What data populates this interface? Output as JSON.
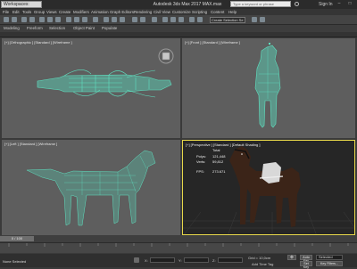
{
  "window": {
    "workspace": "Workspaces: Default",
    "title": "Autodesk 3ds Max 2017    MAX.max",
    "search_placeholder": "Type a keyword or phrase",
    "signin": "Sign In",
    "min": "–",
    "max": "□",
    "close": "✕"
  },
  "menu": [
    "File",
    "Edit",
    "Tools",
    "Group",
    "Views",
    "Create",
    "Modifiers",
    "Animation",
    "Graph Editors",
    "Rendering",
    "Civil View",
    "Customize",
    "Scripting",
    "Content",
    "Help"
  ],
  "toolbar": {
    "selection_set": "Create Selection Se"
  },
  "ribbon": [
    "Modeling",
    "Freeform",
    "Selection",
    "Object Paint",
    "Populate"
  ],
  "viewports": {
    "top": "[+] [Orthographic ] [Standard ] [Wireframe ]",
    "front": "[+] [Front ] [Standard ] [Wireframe ]",
    "left": "[+] [Left ] [Standard ] [Wireframe ]",
    "persp": "[+] [Perspective ] [Standard ] [Default Shading ]"
  },
  "stats": {
    "total_label": "Total",
    "polys_label": "Polys:",
    "polys_value": "121,448",
    "verts_label": "Verts:",
    "verts_value": "59,812",
    "fps_label": "FPS:",
    "fps_value": "273.671"
  },
  "timeline": {
    "frame": "0 / 100"
  },
  "status": {
    "selection": "None Selected",
    "x_label": "X:",
    "y_label": "Y:",
    "z_label": "Z:",
    "grid": "Grid = 10,0cm",
    "add_time_tag": "Add Time Tag",
    "auto_key": "Auto Key",
    "set_key": "Set Key",
    "selected": "Selected",
    "key_filters": "Key Filters..."
  },
  "colors": {
    "wire": "#5fe0c0",
    "active_border": "#e8d84a",
    "horse_body": "#3b2418"
  }
}
